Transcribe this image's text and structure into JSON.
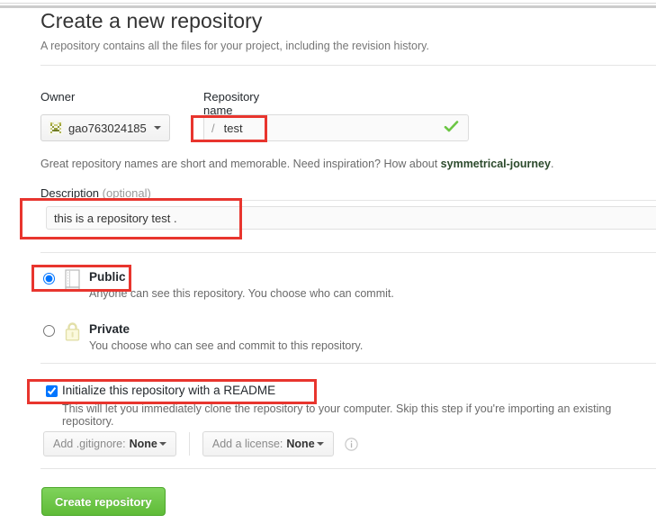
{
  "window": {
    "chrome_visible": true
  },
  "header": {
    "title": "Create a new repository",
    "subtitle": "A repository contains all the files for your project, including the revision history."
  },
  "owner_field": {
    "label": "Owner",
    "selected_owner": "gao763024185",
    "avatar_icon": "identicon-avatar",
    "caret_icon": "caret-down-icon"
  },
  "repo_name_field": {
    "label": "Repository name",
    "separator": "/",
    "value": "test",
    "placeholder": "",
    "validation_icon": "check-icon",
    "validation_color": "#6cc644"
  },
  "name_hint": {
    "text_before": "Great repository names are short and memorable. Need inspiration? How about ",
    "suggestion": "symmetrical-journey",
    "text_after": "."
  },
  "description_field": {
    "label": "Description",
    "optional_note": "(optional)",
    "value": "this is a repository test .",
    "placeholder": ""
  },
  "visibility": {
    "options": [
      {
        "id": "public",
        "title": "Public",
        "description": "Anyone can see this repository. You choose who can commit.",
        "icon": "repo-book-icon",
        "selected": true
      },
      {
        "id": "private",
        "title": "Private",
        "description": "You choose who can see and commit to this repository.",
        "icon": "lock-icon",
        "selected": false
      }
    ]
  },
  "readme_option": {
    "label": "Initialize this repository with a README",
    "description": "This will let you immediately clone the repository to your computer. Skip this step if you're importing an existing repository.",
    "checked": true
  },
  "extras": {
    "gitignore": {
      "prefix": "Add .gitignore:",
      "value": "None",
      "caret_icon": "caret-down-icon"
    },
    "license": {
      "prefix": "Add a license:",
      "value": "None",
      "caret_icon": "caret-down-icon"
    },
    "info_icon": "info-icon"
  },
  "submit": {
    "label": "Create repository",
    "color": "#6cc644"
  },
  "annotations": {
    "accent_color": "#e8352e",
    "boxes": [
      {
        "name": "repo-name-highlight",
        "target": "repo_name_field"
      },
      {
        "name": "description-highlight",
        "target": "description_field"
      },
      {
        "name": "public-option-highlight",
        "target": "visibility.public"
      },
      {
        "name": "readme-option-highlight",
        "target": "readme_option"
      }
    ]
  }
}
